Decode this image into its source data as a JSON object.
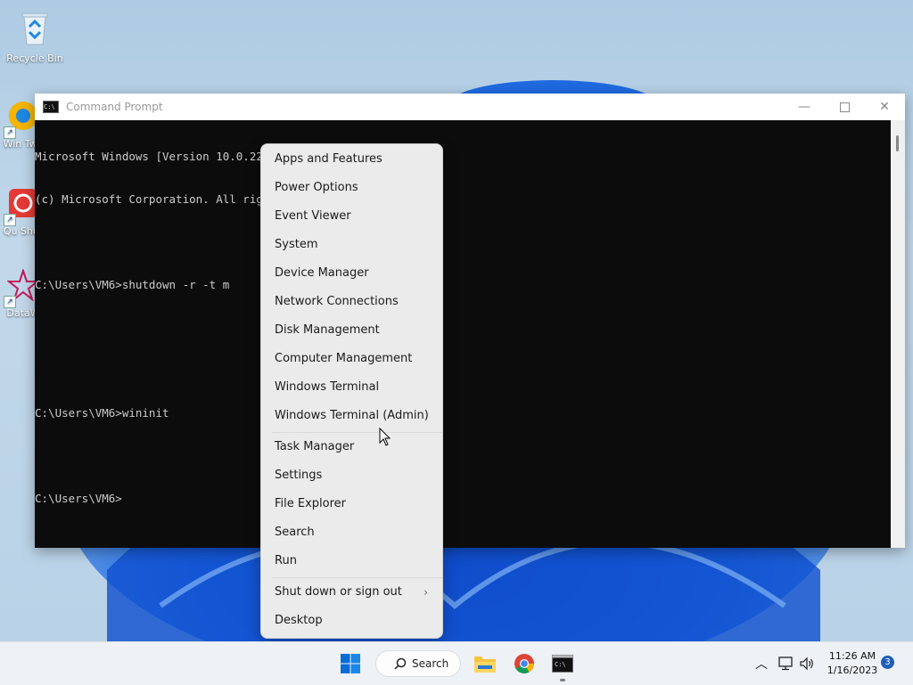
{
  "desktop": {
    "icons": [
      {
        "label": "Recycle Bin"
      },
      {
        "label": "Win Twe"
      },
      {
        "label": "Qu Shut"
      },
      {
        "label": "DataW"
      }
    ]
  },
  "cmd": {
    "title": "Command Prompt",
    "lines": [
      "Microsoft Windows [Version 10.0.22000.1098]",
      "(c) Microsoft Corporation. All rights reserved.",
      "",
      "C:\\Users\\VM6>shutdown -r -t m",
      "",
      "",
      "C:\\Users\\VM6>wininit",
      "",
      "C:\\Users\\VM6>"
    ]
  },
  "menu": {
    "items": [
      "Apps and Features",
      "Power Options",
      "Event Viewer",
      "System",
      "Device Manager",
      "Network Connections",
      "Disk Management",
      "Computer Management",
      "Windows Terminal",
      "Windows Terminal (Admin)",
      "Task Manager",
      "Settings",
      "File Explorer",
      "Search",
      "Run",
      "Shut down or sign out",
      "Desktop"
    ]
  },
  "taskbar": {
    "search_label": "Search",
    "time": "11:26 AM",
    "date": "1/16/2023",
    "notification_count": "3"
  },
  "colors": {
    "accent": "#0067c0",
    "terminal_bg": "#0c0c0c",
    "terminal_text": "#cccccc"
  }
}
